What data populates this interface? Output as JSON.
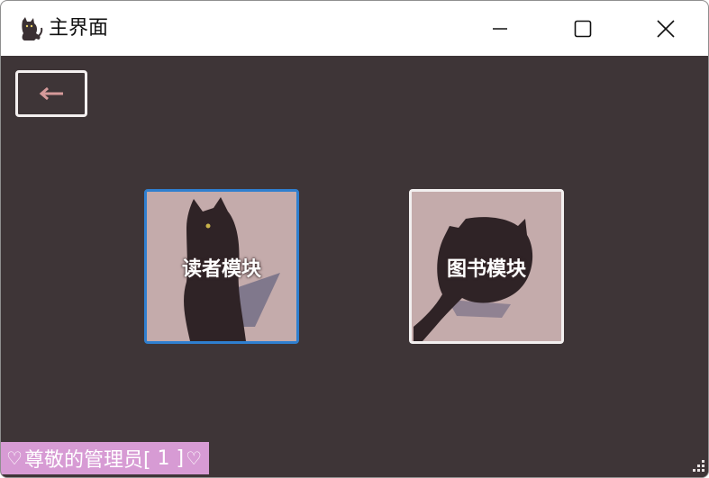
{
  "window": {
    "title": "主界面"
  },
  "toolbar": {
    "back_arrow": "←"
  },
  "modules": [
    {
      "label": "读者模块"
    },
    {
      "label": "图书模块"
    }
  ],
  "status": {
    "heart_left": "♡",
    "text": "尊敬的管理员[",
    "admin_id": " 1 ",
    "close_bracket": "]",
    "heart_right": "♡"
  },
  "colors": {
    "background": "#3e3537",
    "tile": "#c4abab",
    "status_bar": "#d79bd4",
    "selected_border": "#2f7fcf"
  }
}
